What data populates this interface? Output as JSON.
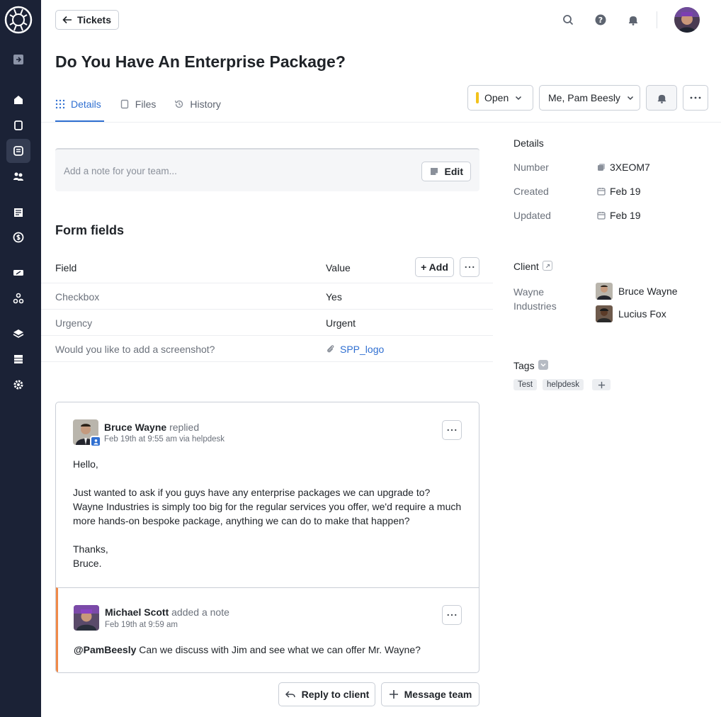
{
  "header": {
    "back_label": "Tickets",
    "title": "Do You Have An Enterprise Package?"
  },
  "tabs": [
    {
      "label": "Details",
      "icon": "grid-dots-icon"
    },
    {
      "label": "Files",
      "icon": "file-icon"
    },
    {
      "label": "History",
      "icon": "history-icon"
    }
  ],
  "actions": {
    "status": "Open",
    "status_color": "#f2c21b",
    "assignee": "Me, Pam Beesly"
  },
  "note": {
    "placeholder": "Add a note for your team...",
    "edit_label": "Edit"
  },
  "form_fields": {
    "title": "Form fields",
    "col_field": "Field",
    "col_value": "Value",
    "add_label": "+ Add",
    "rows": [
      {
        "field": "Checkbox",
        "value": "Yes"
      },
      {
        "field": "Urgency",
        "value": "Urgent"
      },
      {
        "field": "Would you like to add a screenshot?",
        "value": "SPP_logo"
      }
    ]
  },
  "messages": [
    {
      "author": "Bruce Wayne",
      "action": "replied",
      "meta": "Feb 19th at 9:55 am via helpdesk",
      "body": [
        "Hello,",
        "Just wanted to ask if you guys have any enterprise packages we can upgrade to? Wayne Industries is simply too big for the regular services you offer, we'd require a much more hands-on bespoke package, anything we can do to make that happen?",
        "Thanks,",
        "Bruce."
      ]
    },
    {
      "author": "Michael Scott",
      "action": "added a note",
      "meta": "Feb 19th at 9:59 am",
      "mention": "@PamBeesly",
      "body": "Can we discuss with Jim and see what we can offer Mr. Wayne?"
    }
  ],
  "footer": {
    "reply_label": "Reply to client",
    "message_team_label": "Message team"
  },
  "details": {
    "title": "Details",
    "number_label": "Number",
    "number": "3XEOM7",
    "created_label": "Created",
    "created": "Feb 19",
    "updated_label": "Updated",
    "updated": "Feb 19"
  },
  "client": {
    "title": "Client",
    "company": "Wayne Industries",
    "people": [
      "Bruce Wayne",
      "Lucius Fox"
    ]
  },
  "tags": {
    "title": "Tags",
    "items": [
      "Test",
      "helpdesk"
    ]
  },
  "colors": {
    "sidebar": "#1b2236",
    "accent": "#2f6fd1",
    "note_accent": "#f08a49"
  }
}
